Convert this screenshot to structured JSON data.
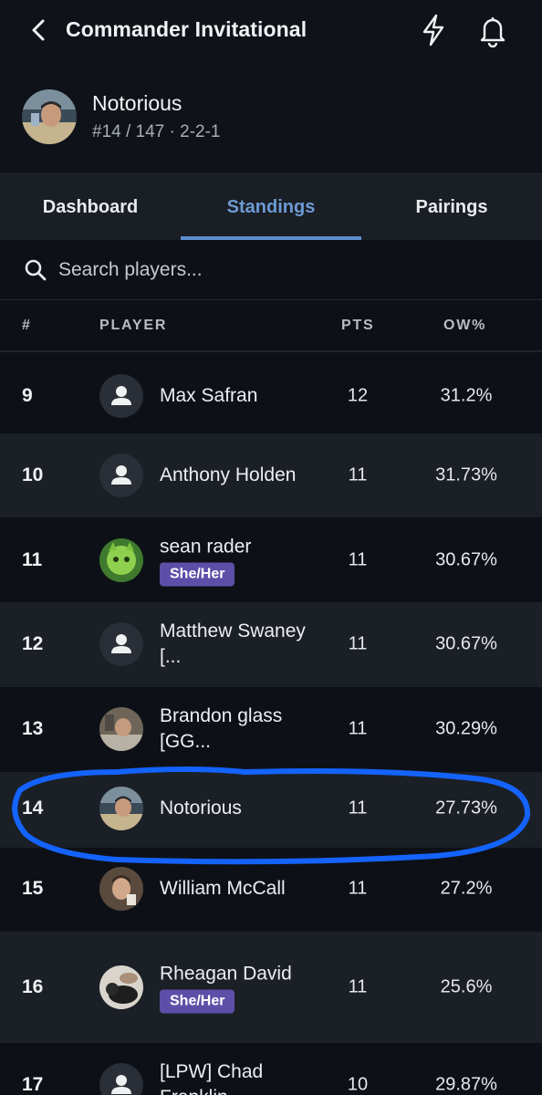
{
  "header": {
    "title": "Commander Invitational"
  },
  "profile": {
    "name": "Notorious",
    "meta": "#14 / 147 · 2-2-1"
  },
  "tabs": [
    {
      "label": "Dashboard"
    },
    {
      "label": "Standings",
      "active": true
    },
    {
      "label": "Pairings"
    }
  ],
  "search": {
    "placeholder": "Search players..."
  },
  "columns": {
    "rank": "#",
    "player": "PLAYER",
    "pts": "PTS",
    "ow": "OW%"
  },
  "rows": [
    {
      "rank": "9",
      "name": "Max Safran",
      "pts": "12",
      "ow": "31.2%",
      "pronouns": "",
      "avatar": "person-placeholder-icon"
    },
    {
      "rank": "10",
      "name": "Anthony Holden",
      "pts": "11",
      "ow": "31.73%",
      "pronouns": "",
      "avatar": "person-placeholder-icon"
    },
    {
      "rank": "11",
      "name": "sean rader",
      "pts": "11",
      "ow": "30.67%",
      "pronouns": "She/Her",
      "avatar": "green-cat-photo"
    },
    {
      "rank": "12",
      "name": "Matthew Swaney [...",
      "pts": "11",
      "ow": "30.67%",
      "pronouns": "",
      "avatar": "person-placeholder-icon"
    },
    {
      "rank": "13",
      "name": "Brandon glass [GG...",
      "pts": "11",
      "ow": "30.29%",
      "pronouns": "",
      "avatar": "user-photo"
    },
    {
      "rank": "14",
      "name": "Notorious",
      "pts": "11",
      "ow": "27.73%",
      "pronouns": "",
      "avatar": "user-photo"
    },
    {
      "rank": "15",
      "name": "William McCall",
      "pts": "11",
      "ow": "27.2%",
      "pronouns": "",
      "avatar": "user-photo"
    },
    {
      "rank": "16",
      "name": "Rheagan David",
      "pts": "11",
      "ow": "25.6%",
      "pronouns": "She/Her",
      "avatar": "cat-photo"
    },
    {
      "rank": "17",
      "name": "[LPW] Chad Franklin",
      "pts": "10",
      "ow": "29.87%",
      "pronouns": "",
      "avatar": "person-placeholder-icon"
    }
  ],
  "colors": {
    "accent": "#5b8dd0",
    "pronoun_badge": "#5d4fa8",
    "highlight_circle": "#1463ff"
  }
}
